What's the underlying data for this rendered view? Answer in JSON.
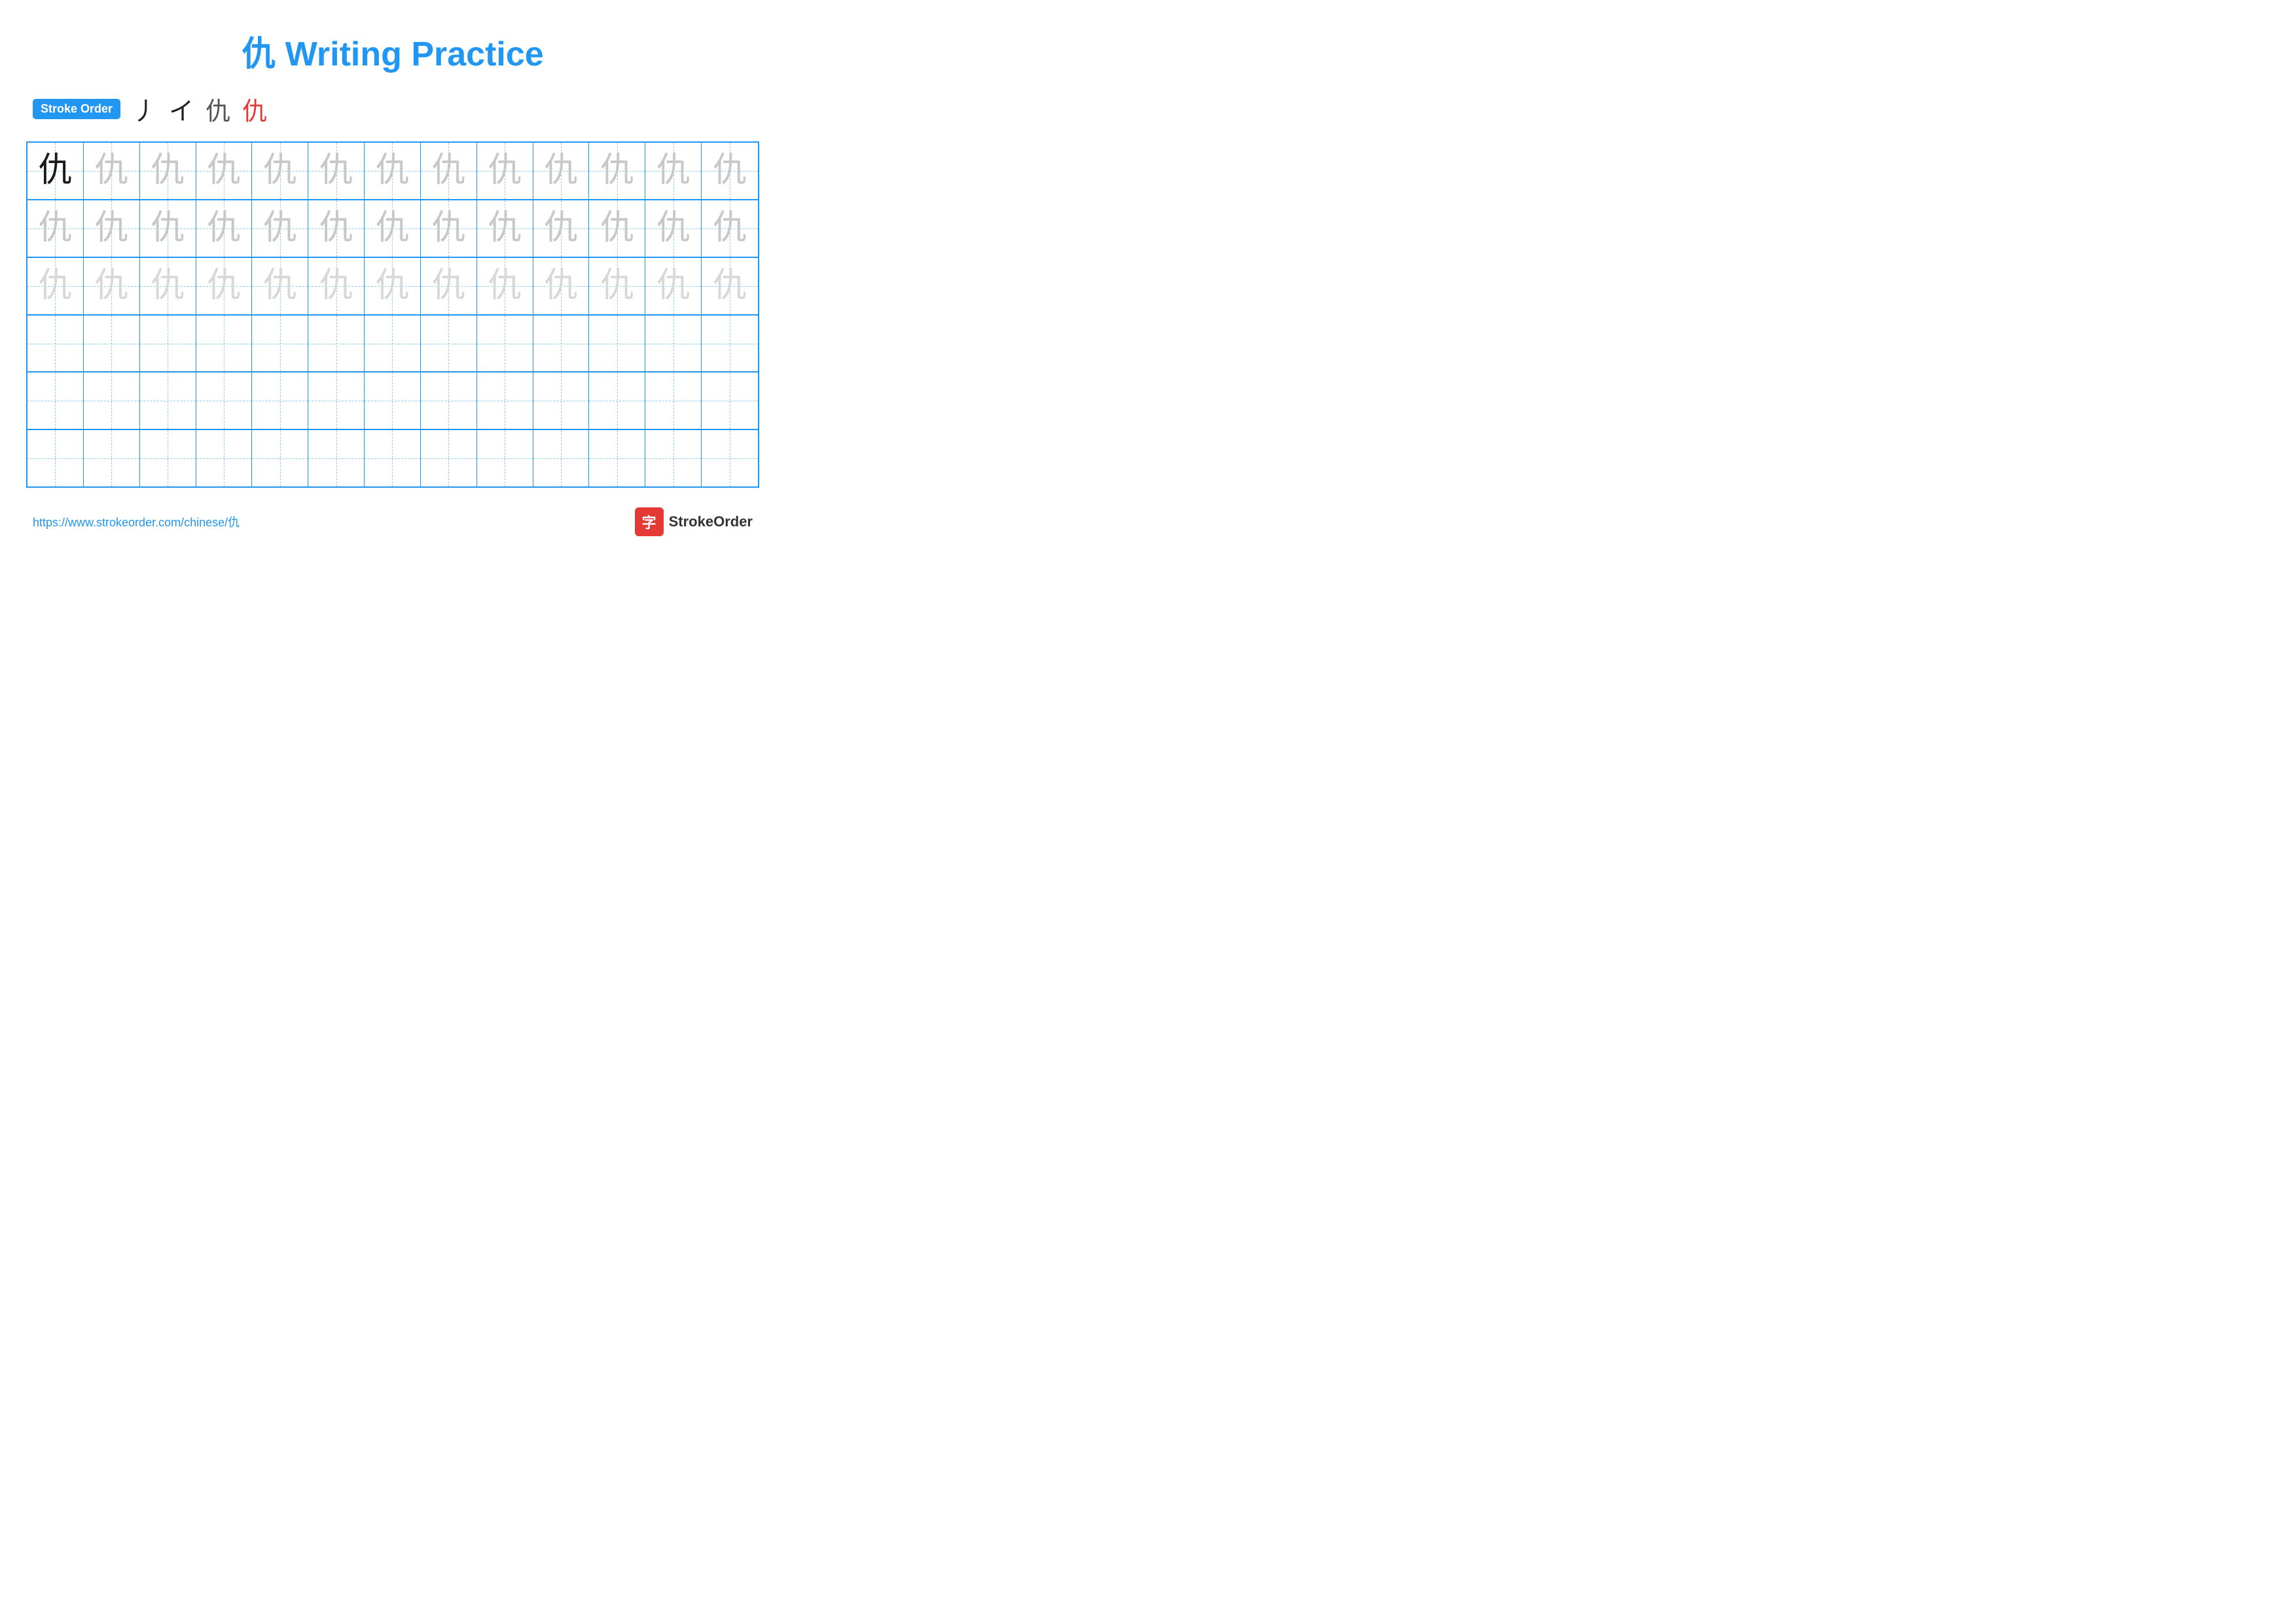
{
  "title": {
    "char": "仇",
    "text": "Writing Practice",
    "full": "仇 Writing Practice"
  },
  "stroke_order": {
    "label": "Stroke Order",
    "strokes": [
      "丿",
      "イ",
      "仇",
      "仇"
    ]
  },
  "grid": {
    "rows": 6,
    "cols": 13,
    "row_data": [
      {
        "type": "dark-then-light",
        "chars": [
          "仇",
          "仇",
          "仇",
          "仇",
          "仇",
          "仇",
          "仇",
          "仇",
          "仇",
          "仇",
          "仇",
          "仇",
          "仇"
        ]
      },
      {
        "type": "light",
        "chars": [
          "仇",
          "仇",
          "仇",
          "仇",
          "仇",
          "仇",
          "仇",
          "仇",
          "仇",
          "仇",
          "仇",
          "仇",
          "仇"
        ]
      },
      {
        "type": "lighter",
        "chars": [
          "仇",
          "仇",
          "仇",
          "仇",
          "仇",
          "仇",
          "仇",
          "仇",
          "仇",
          "仇",
          "仇",
          "仇",
          "仇"
        ]
      },
      {
        "type": "empty",
        "chars": [
          "",
          "",
          "",
          "",
          "",
          "",
          "",
          "",
          "",
          "",
          "",
          "",
          ""
        ]
      },
      {
        "type": "empty",
        "chars": [
          "",
          "",
          "",
          "",
          "",
          "",
          "",
          "",
          "",
          "",
          "",
          "",
          ""
        ]
      },
      {
        "type": "empty",
        "chars": [
          "",
          "",
          "",
          "",
          "",
          "",
          "",
          "",
          "",
          "",
          "",
          "",
          ""
        ]
      }
    ]
  },
  "footer": {
    "url": "https://www.strokeorder.com/chinese/仇",
    "brand": "StrokeOrder",
    "brand_char": "字"
  }
}
